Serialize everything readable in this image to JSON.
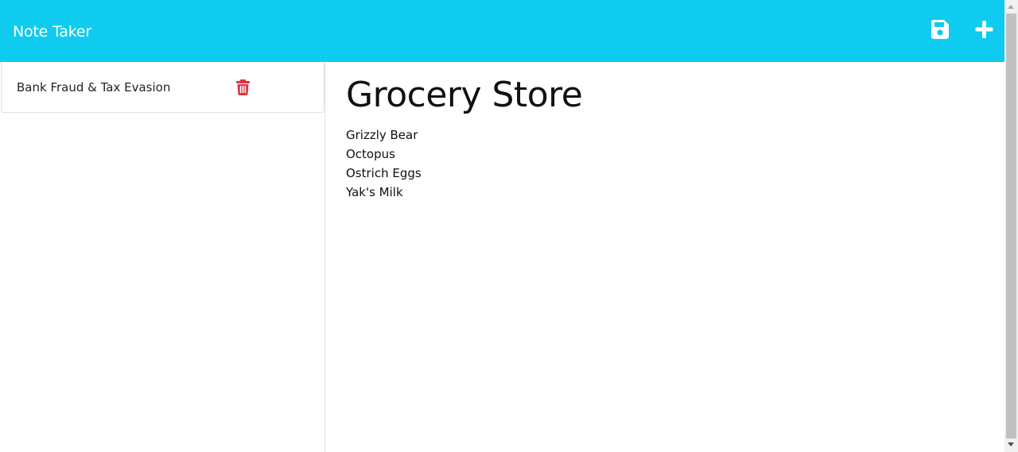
{
  "app": {
    "title": "Note Taker"
  },
  "toolbar": {
    "save_icon": "save-icon",
    "new_icon": "plus-icon"
  },
  "sidebar": {
    "notes": [
      {
        "title": "Bank Fraud & Tax Evasion",
        "delete_icon": "trash-icon"
      }
    ]
  },
  "editor": {
    "title": "Grocery Store",
    "lines": [
      "Grizzly Bear",
      "Octopus",
      "Ostrich Eggs",
      "Yak's Milk"
    ]
  },
  "colors": {
    "navbar": "#0fcbf0",
    "delete": "#dc3545",
    "text": "#111111"
  }
}
